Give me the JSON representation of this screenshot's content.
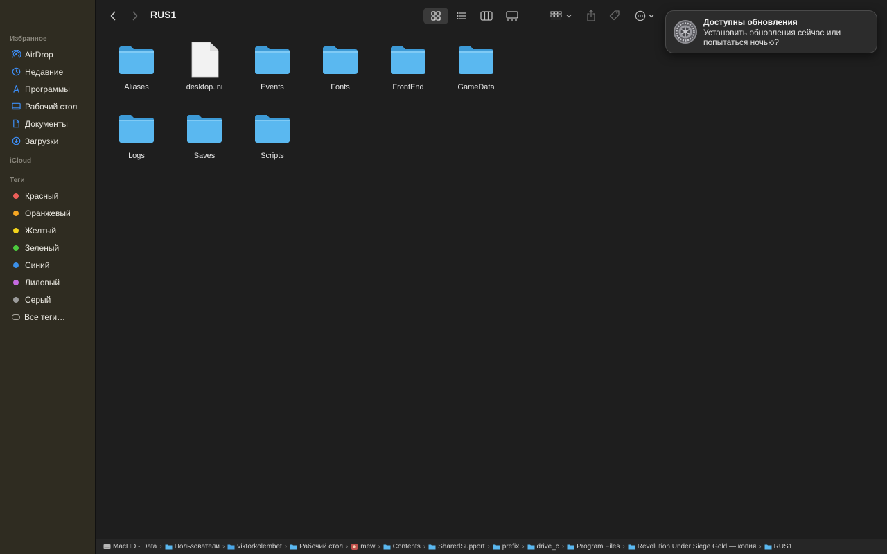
{
  "window": {
    "title": "RUS1"
  },
  "sidebar": {
    "sections": [
      {
        "label": "Избранное",
        "items": [
          {
            "label": "AirDrop",
            "icon": "airdrop-icon"
          },
          {
            "label": "Недавние",
            "icon": "clock-icon"
          },
          {
            "label": "Программы",
            "icon": "apps-icon"
          },
          {
            "label": "Рабочий стол",
            "icon": "desktop-icon"
          },
          {
            "label": "Документы",
            "icon": "document-icon"
          },
          {
            "label": "Загрузки",
            "icon": "download-icon"
          }
        ]
      },
      {
        "label": "iCloud",
        "items": []
      },
      {
        "label": "Теги",
        "items": [
          {
            "label": "Красный",
            "color": "#ec5f59"
          },
          {
            "label": "Оранжевый",
            "color": "#f5a623"
          },
          {
            "label": "Желтый",
            "color": "#f2d31b"
          },
          {
            "label": "Зеленый",
            "color": "#4cc93d"
          },
          {
            "label": "Синий",
            "color": "#3b8fe8"
          },
          {
            "label": "Лиловый",
            "color": "#c66ae0"
          },
          {
            "label": "Серый",
            "color": "#9b9b9b"
          },
          {
            "label": "Все теги…",
            "color": ""
          }
        ]
      }
    ]
  },
  "toolbar": {
    "back_icon": "chevron-left-icon",
    "forward_icon": "chevron-right-icon",
    "active_view": "icon-view"
  },
  "notification": {
    "title": "Доступны обновления",
    "body": "Установить обновления сейчас или попытаться ночью?",
    "icon": "system-settings-gear-icon"
  },
  "files": [
    {
      "name": "Aliases",
      "kind": "folder"
    },
    {
      "name": "desktop.ini",
      "kind": "file"
    },
    {
      "name": "Events",
      "kind": "folder"
    },
    {
      "name": "Fonts",
      "kind": "folder"
    },
    {
      "name": "FrontEnd",
      "kind": "folder"
    },
    {
      "name": "GameData",
      "kind": "folder"
    },
    {
      "name": "Logs",
      "kind": "folder"
    },
    {
      "name": "Saves",
      "kind": "folder"
    },
    {
      "name": "Scripts",
      "kind": "folder"
    }
  ],
  "pathbar": [
    {
      "label": "MacHD - Data",
      "icon": "disk"
    },
    {
      "label": "Пользователи",
      "icon": "folder"
    },
    {
      "label": "viktorkolembet",
      "icon": "home-folder"
    },
    {
      "label": "Рабочий стол",
      "icon": "folder"
    },
    {
      "label": "mew",
      "icon": "app"
    },
    {
      "label": "Contents",
      "icon": "folder"
    },
    {
      "label": "SharedSupport",
      "icon": "folder"
    },
    {
      "label": "prefix",
      "icon": "folder"
    },
    {
      "label": "drive_c",
      "icon": "folder"
    },
    {
      "label": "Program Files",
      "icon": "folder"
    },
    {
      "label": "Revolution Under Siege Gold — копия",
      "icon": "folder"
    },
    {
      "label": "RUS1",
      "icon": "folder"
    }
  ],
  "colors": {
    "folder": "#5ab8f0",
    "sidebar_icon": "#3d8ef7"
  }
}
